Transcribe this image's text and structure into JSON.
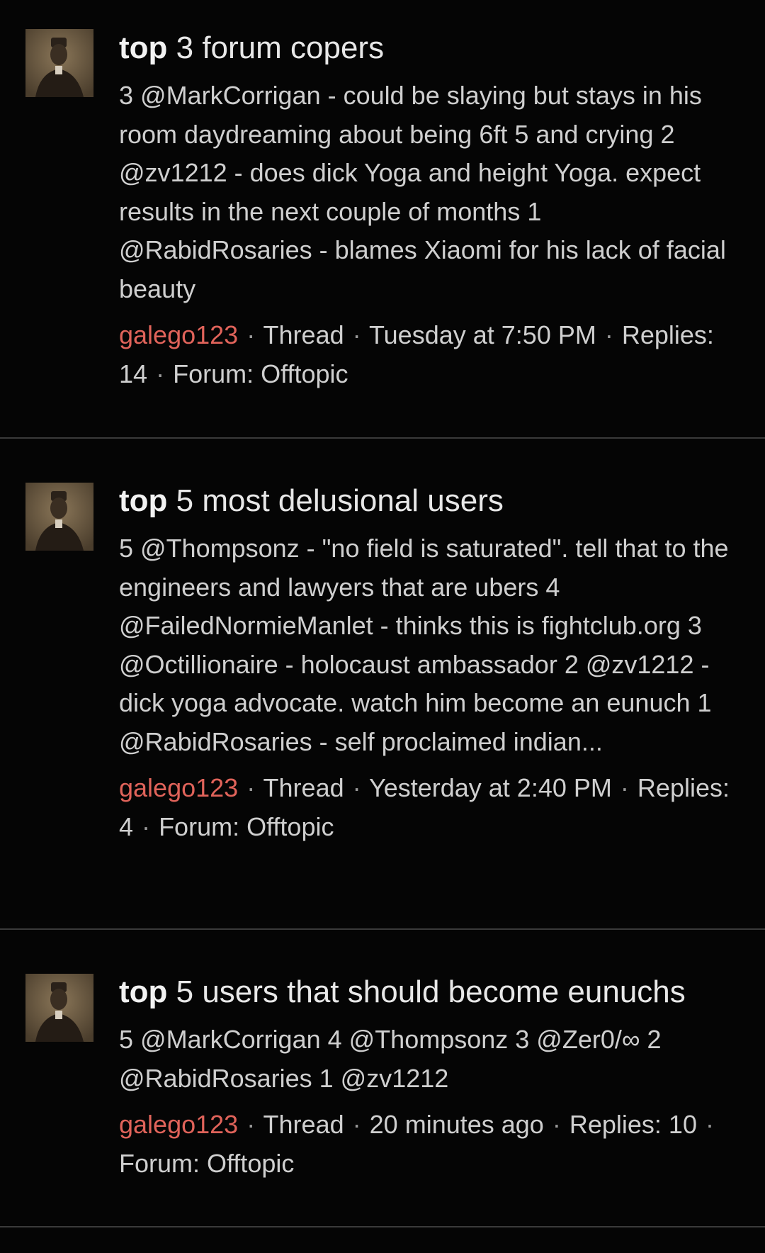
{
  "results": [
    {
      "title_highlight": "top",
      "title_rest": " 3 forum copers",
      "snippet": "3 @MarkCorrigan - could be slaying but stays in his room daydreaming about being 6ft 5 and crying 2 @zv1212 - does dick Yoga and height Yoga. expect results in the next couple of months 1 @RabidRosaries - blames Xiaomi for his lack of facial beauty",
      "author": "galego123",
      "type": "Thread",
      "date": "Tuesday at 7:50 PM",
      "replies": "Replies: 14",
      "forum": "Forum: Offtopic"
    },
    {
      "title_highlight": "top",
      "title_rest": " 5 most delusional users",
      "snippet": "5 @Thompsonz - \"no field is saturated\". tell that to the engineers and lawyers that are ubers 4 @FailedNormieManlet - thinks this is fightclub.org 3 @Octillionaire - holocaust ambassador 2 @zv1212 - dick yoga advocate. watch him become an eunuch 1 @RabidRosaries - self proclaimed indian...",
      "author": "galego123",
      "type": "Thread",
      "date": "Yesterday at 2:40 PM",
      "replies": "Replies: 4",
      "forum": "Forum: Offtopic"
    },
    {
      "title_highlight": "top",
      "title_rest": " 5 users that should become eunuchs",
      "snippet": "5 @MarkCorrigan 4 @Thompsonz 3 @Zer0/∞ 2 @RabidRosaries 1 @zv1212",
      "author": "galego123",
      "type": "Thread",
      "date": "20 minutes ago",
      "replies": "Replies: 10",
      "forum": "Forum: Offtopic"
    }
  ],
  "separator": "·",
  "colors": {
    "background": "#050505",
    "author": "#e0635a",
    "text": "#cfcfcf",
    "divider": "#3a3a3a"
  }
}
